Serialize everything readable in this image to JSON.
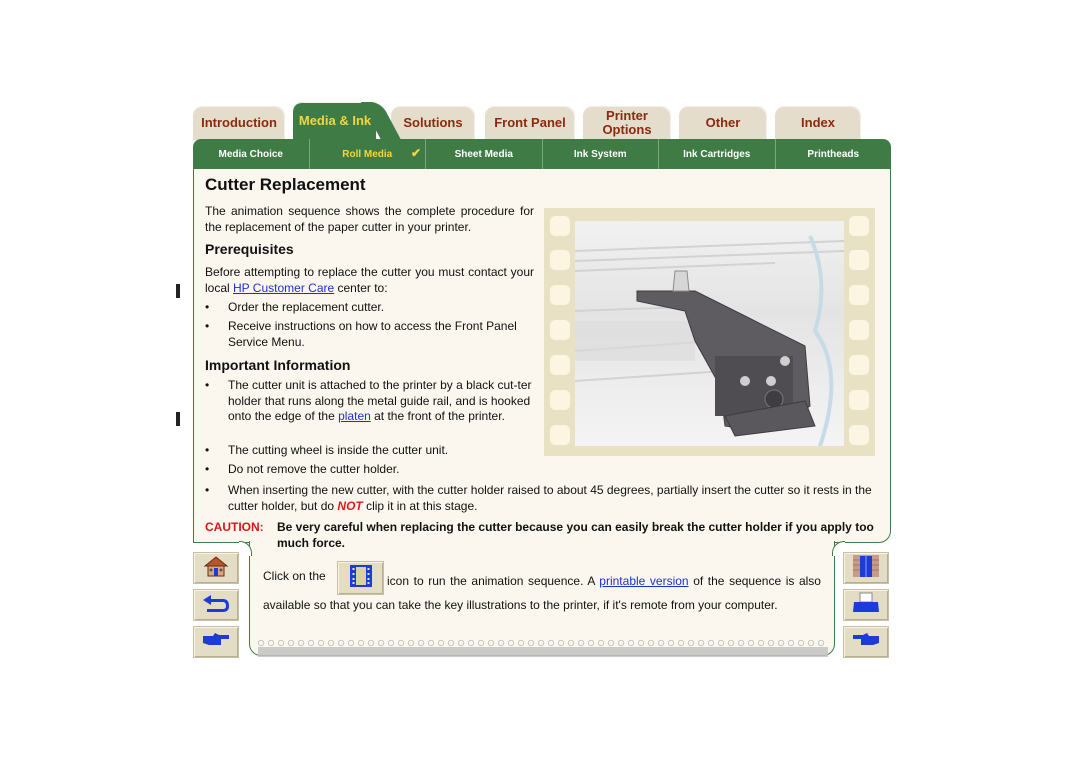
{
  "tabs": [
    {
      "label": "Introduction",
      "active": false
    },
    {
      "label": "Media & Ink",
      "active": true
    },
    {
      "label": "Solutions",
      "active": false
    },
    {
      "label": "Front Panel",
      "active": false
    },
    {
      "label": "Printer Options",
      "active": false
    },
    {
      "label": "Other",
      "active": false
    },
    {
      "label": "Index",
      "active": false
    }
  ],
  "subnav": [
    {
      "label": "Media Choice",
      "active": false
    },
    {
      "label": "Roll Media",
      "active": true,
      "check": "✔"
    },
    {
      "label": "Sheet Media",
      "active": false
    },
    {
      "label": "Ink System",
      "active": false
    },
    {
      "label": "Ink Cartridges",
      "active": false
    },
    {
      "label": "Printheads",
      "active": false
    }
  ],
  "content": {
    "title": "Cutter Replacement",
    "intro": "The animation sequence shows the complete procedure for the replacement of the paper cutter in your printer.",
    "prereq_heading": "Prerequisites",
    "prereq_text_before": "Before attempting to replace the cutter you must contact your local ",
    "prereq_link": "HP Customer Care",
    "prereq_text_after": " center to:",
    "prereq_bullets": [
      "Order the replacement cutter.",
      "Receive instructions on how to access the Front Panel Service Menu."
    ],
    "info_heading": "Important Information",
    "info_bullet1_before": "The cutter unit is attached to the printer by a black cut-ter holder that runs along the metal guide rail, and is hooked onto the edge of the ",
    "info_bullet1_link": "platen",
    "info_bullet1_after": " at the front of the printer.",
    "info_bullet2": "The cutting wheel is inside the cutter unit.",
    "info_bullet3": "Do not remove the cutter holder.",
    "info_bullet4_before": "When inserting the new cutter, with the cutter holder raised to about 45 degrees, partially insert the cutter so it rests in the cutter holder, but do ",
    "info_bullet4_emph": "NOT",
    "info_bullet4_after": " clip it in at this stage.",
    "bullet_char": "•",
    "caution_label": "CAUTION:",
    "caution_text": "Be very careful when replacing the cutter because you can easily break the cutter holder if you apply too much force.",
    "click_before": "Click on the",
    "click_middle": "icon to run the animation sequence. A ",
    "click_link": "printable version",
    "click_after": " of the sequence is also available so that you can take the key illustrations to the printer, if it's remote from your computer."
  },
  "image": {
    "alt": "Cutter unit mounted on printer guide rail (film frame)"
  },
  "nav_left": [
    "home-icon",
    "back-icon",
    "next-page-icon"
  ],
  "nav_right": [
    "contents-icon",
    "print-icon",
    "previous-page-icon"
  ],
  "colors": {
    "accent_green": "#3f7b45",
    "tab_active_text": "#f4d63c",
    "tab_text": "#8a2a0e",
    "link": "#1b2fd8",
    "caution": "#d8161c"
  }
}
